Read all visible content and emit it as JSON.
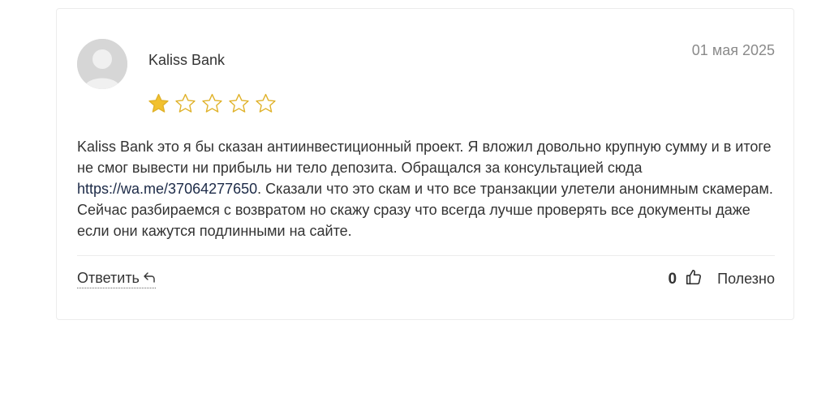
{
  "review": {
    "author": "Kaliss Bank",
    "date": "01 мая 2025",
    "rating": 1,
    "rating_max": 5,
    "text_before_link": "Kaliss Bank это я бы сказан антиинвестиционный проект. Я вложил довольно крупную сумму и в итоге не смог вывести ни прибыль ни тело депозита. Обращался за консультацией сюда ",
    "link_text": "https://wa.me/37064277650",
    "text_after_link": ". Сказали что это скам и что все транзакции улетели анонимным скамерам. Сейчас разбираемся с возвратом но скажу сразу что всегда лучше проверять все документы даже если они кажутся подлинными на сайте."
  },
  "actions": {
    "reply_label": "Ответить",
    "reply_icon": "reply-arrow-icon",
    "useful_count": "0",
    "useful_icon": "thumbs-up-icon",
    "useful_label": "Полезно"
  },
  "colors": {
    "star_filled": "#f2c12e",
    "star_empty_stroke": "#e0b22a"
  }
}
